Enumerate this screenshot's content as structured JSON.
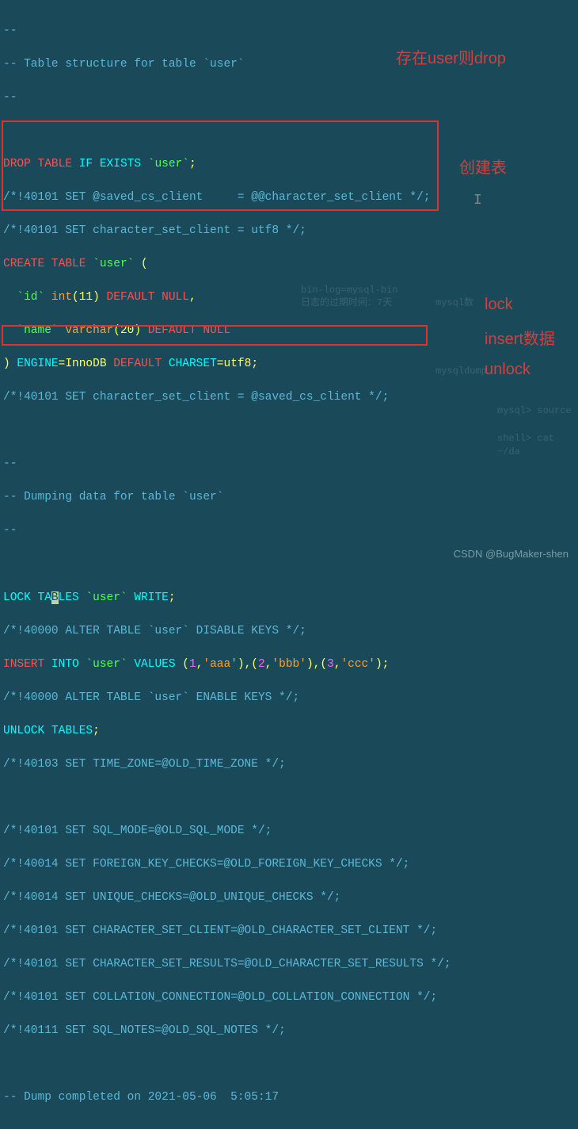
{
  "annotations": {
    "drop_note": "存在user则drop",
    "create_note": "创建表",
    "lock_note": "lock",
    "insert_note": "insert数据",
    "unlock_note": "unlock"
  },
  "comments": {
    "table_struct": "-- Table structure for table `user`",
    "dashes": "--",
    "dump_data": "-- Dumping data for table `user`",
    "set_saved": "/*!40101 SET @saved_cs_client     = @@character_set_client */;",
    "set_utf8": "/*!40101 SET character_set_client = utf8 */;",
    "set_saved2": "/*!40101 SET character_set_client = @saved_cs_client */;",
    "alter_disable": "/*!40000 ALTER TABLE `user` DISABLE KEYS */;",
    "alter_enable": "/*!40000 ALTER TABLE `user` ENABLE KEYS */;",
    "tz": "/*!40103 SET TIME_ZONE=@OLD_TIME_ZONE */;",
    "sql_mode": "/*!40101 SET SQL_MODE=@OLD_SQL_MODE */;",
    "fk": "/*!40014 SET FOREIGN_KEY_CHECKS=@OLD_FOREIGN_KEY_CHECKS */;",
    "uniq": "/*!40014 SET UNIQUE_CHECKS=@OLD_UNIQUE_CHECKS */;",
    "cs_client": "/*!40101 SET CHARACTER_SET_CLIENT=@OLD_CHARACTER_SET_CLIENT */;",
    "cs_results": "/*!40101 SET CHARACTER_SET_RESULTS=@OLD_CHARACTER_SET_RESULTS */;",
    "collation": "/*!40101 SET COLLATION_CONNECTION=@OLD_COLLATION_CONNECTION */;",
    "sql_notes": "/*!40111 SET SQL_NOTES=@OLD_SQL_NOTES */;",
    "dump_complete": "-- Dump completed on 2021-05-06  5:05:17"
  },
  "sql": {
    "drop": {
      "kw1": "DROP",
      "kw2": "TABLE",
      "kw3": "IF",
      "kw4": "EXISTS",
      "tbl": "`user`",
      "semi": ";"
    },
    "create": {
      "kw1": "CREATE",
      "kw2": "TABLE",
      "tbl": "`user`",
      "open": " (",
      "id": "  `id`",
      "id_type": " int",
      "id_n": "(11)",
      "def": " DEFAULT NULL",
      "comma": ",",
      "name": "  `name`",
      "name_type": " varchar",
      "name_n": "(20)",
      "close": ")",
      "engine": " ENGINE",
      "eq": "=InnoDB",
      "def2": " DEFAULT",
      "charset": " CHARSET",
      "eq2": "=utf8"
    },
    "lock": {
      "kw1": "LOCK",
      "kw2": "TABLES",
      "tbl": " `user`",
      "kw3": " WRITE"
    },
    "insert": {
      "kw1": "INSERT",
      "kw2": " INTO",
      "tbl": " `user`",
      "kw3": " VALUES",
      "vals": " (1,'aaa'),(2,'bbb'),(3,'ccc')",
      "n1": "1",
      "s1": "'aaa'",
      "n2": "2",
      "s2": "'bbb'",
      "n3": "3",
      "s3": "'ccc'"
    },
    "unlock": {
      "kw1": "UNLOCK",
      "kw2": " TABLES"
    }
  },
  "watermark": "CSDN @BugMaker-shen",
  "bg": {
    "binlog": "bin-log=mysql-bin",
    "logtime": "日志的过期时间：7天",
    "mysql": "mysql数",
    "dump": "mysqldump",
    "source": "mysql> source",
    "cat": "shell> cat ~/da"
  }
}
